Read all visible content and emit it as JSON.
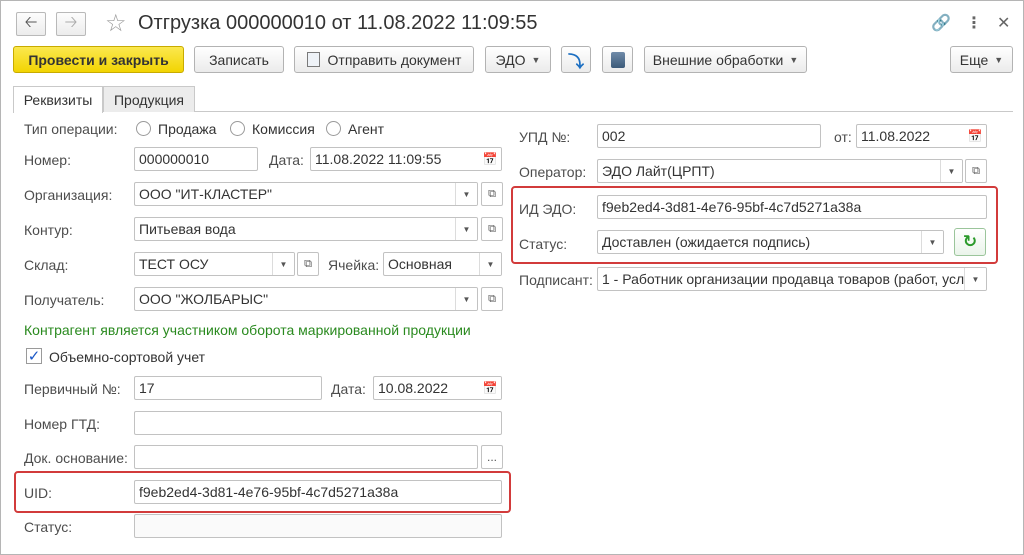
{
  "window": {
    "title": "Отгрузка 000000010 от 11.08.2022 11:09:55",
    "back_icon": "arrow-left-icon",
    "forward_icon": "arrow-right-icon",
    "favorite_icon": "star-icon",
    "link_icon": "link-icon",
    "more_icon": "more-vertical-icon",
    "close_icon": "close-icon"
  },
  "toolbar": {
    "post_close": "Провести и закрыть",
    "save": "Записать",
    "send_doc": "Отправить документ",
    "edo": "ЭДО",
    "more": "Еще",
    "external": "Внешние обработки"
  },
  "tabs": [
    "Реквизиты",
    "Продукция"
  ],
  "left": {
    "op_type_label": "Тип операции:",
    "op_options": [
      "Продажа",
      "Комиссия",
      "Агент"
    ],
    "number_label": "Номер:",
    "number_value": "000000010",
    "date_label": "Дата:",
    "date_value": "11.08.2022 11:09:55",
    "org_label": "Организация:",
    "org_value": "ООО \"ИТ-КЛАСТЕР\"",
    "contour_label": "Контур:",
    "contour_value": "Питьевая вода",
    "warehouse_label": "Склад:",
    "warehouse_value": "ТЕСТ ОСУ",
    "cell_label": "Ячейка:",
    "cell_value": "Основная",
    "recipient_label": "Получатель:",
    "recipient_value": "ООО \"ЖОЛБАРЫС\"",
    "contractor_note": "Контрагент является участником оборота маркированной продукции",
    "bulk_label": "Объемно-сортовой учет",
    "bulk_checked": true,
    "primary_no_label": "Первичный №:",
    "primary_no_value": "17",
    "primary_date_label": "Дата:",
    "primary_date_value": "10.08.2022",
    "gtd_label": "Номер ГТД:",
    "gtd_value": "",
    "basis_label": "Док. основание:",
    "basis_value": "",
    "basis_btn": "...",
    "uid_label": "UID:",
    "uid_value": "f9eb2ed4-3d81-4e76-95bf-4c7d5271a38a",
    "status_label": "Статус:",
    "status_value": ""
  },
  "right": {
    "upd_label": "УПД №:",
    "upd_value": "002",
    "from_label": "от:",
    "from_value": "11.08.2022",
    "operator_label": "Оператор:",
    "operator_value": "ЭДО Лайт(ЦРПТ)",
    "edo_id_label": "ИД ЭДО:",
    "edo_id_value": "f9eb2ed4-3d81-4e76-95bf-4c7d5271a38a",
    "status_label": "Статус:",
    "status_value": "Доставлен (ожидается подпись)",
    "signer_label": "Подписант:",
    "signer_value": "1 - Работник организации продавца товаров (работ, усл"
  },
  "colors": {
    "primary_button": "#f2d402",
    "highlight": "#d23b3b",
    "note_green": "#2a8a1f",
    "check_blue": "#1a57c7"
  }
}
